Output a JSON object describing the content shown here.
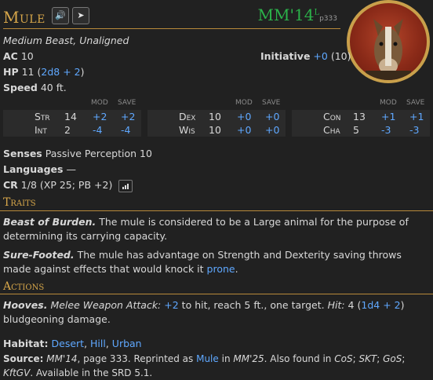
{
  "creature": {
    "name": "Mule",
    "source_abbr": "MM'14",
    "source_sup": "L",
    "source_page": "p333",
    "type_line": "Medium Beast, Unaligned",
    "ac_label": "AC",
    "ac_value": "10",
    "initiative_label": "Initiative",
    "initiative_mod": "+0",
    "initiative_score": "(10)",
    "hp_label": "HP",
    "hp_value": "11",
    "hp_formula": "2d8 + 2",
    "speed_label": "Speed",
    "speed_value": "40 ft."
  },
  "header_buttons": {
    "sound_icon": "speaker-icon",
    "pin_icon": "send-icon"
  },
  "abilities": {
    "mod_label": "MOD",
    "save_label": "SAVE",
    "groups": [
      [
        {
          "name": "Str",
          "score": "14",
          "mod": "+2",
          "save": "+2"
        },
        {
          "name": "Int",
          "score": "2",
          "mod": "-4",
          "save": "-4"
        }
      ],
      [
        {
          "name": "Dex",
          "score": "10",
          "mod": "+0",
          "save": "+0"
        },
        {
          "name": "Wis",
          "score": "10",
          "mod": "+0",
          "save": "+0"
        }
      ],
      [
        {
          "name": "Con",
          "score": "13",
          "mod": "+1",
          "save": "+1"
        },
        {
          "name": "Cha",
          "score": "5",
          "mod": "-3",
          "save": "-3"
        }
      ]
    ]
  },
  "details": {
    "senses_label": "Senses",
    "senses_value": "Passive Perception 10",
    "languages_label": "Languages",
    "languages_value": "—",
    "cr_label": "CR",
    "cr_value": "1/8 (XP 25; PB +2)",
    "cr_button_icon": "bar-chart-icon"
  },
  "traits": {
    "title": "Traits",
    "items": [
      {
        "name": "Beast of Burden.",
        "text": "The mule is considered to be a Large animal for the purpose of determining its carrying capacity."
      },
      {
        "name": "Sure-Footed.",
        "text_before": "The mule has advantage on Strength and Dexterity saving throws made against effects that would knock it",
        "link": "prone",
        "text_after": "."
      }
    ]
  },
  "actions": {
    "title": "Actions",
    "items": [
      {
        "name": "Hooves.",
        "attack": "Melee Weapon Attack:",
        "bonus": "+2",
        "mid": "to hit, reach 5 ft., one target.",
        "hit_label": "Hit:",
        "damage": "4",
        "formula": "1d4 + 2",
        "after": "bludgeoning damage."
      }
    ]
  },
  "footer": {
    "habitat_label": "Habitat:",
    "habitats": [
      "Desert",
      "Hill",
      "Urban"
    ],
    "source_label": "Source:",
    "source_book": "MM'14",
    "source_text1": ", page 333. Reprinted as",
    "source_link": "Mule",
    "source_text2": "in",
    "source_book2": "MM'25",
    "source_text3": ". Also found in",
    "source_book3": "CoS",
    "source_book4": "SKT",
    "source_book5": "GoS",
    "source_book6": "KftGV",
    "source_text4": ". Available in the SRD 5.1."
  }
}
